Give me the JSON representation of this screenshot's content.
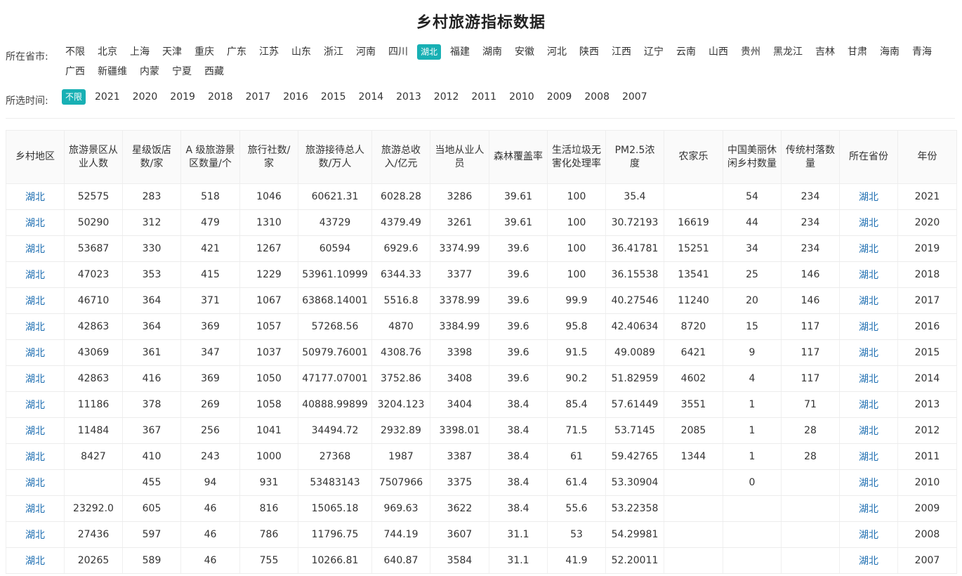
{
  "page": {
    "title": "乡村旅游指标数据"
  },
  "filters": {
    "province_label": "所在省市:",
    "provinces": [
      "不限",
      "北京",
      "上海",
      "天津",
      "重庆",
      "广东",
      "江苏",
      "山东",
      "浙江",
      "河南",
      "四川",
      "湖北",
      "福建",
      "湖南",
      "安徽",
      "河北",
      "陕西",
      "江西",
      "辽宁",
      "云南",
      "山西",
      "贵州",
      "黑龙江",
      "吉林",
      "甘肃",
      "海南",
      "青海",
      "广西",
      "新疆维",
      "内蒙",
      "宁夏",
      "西藏"
    ],
    "province_selected": "湖北",
    "time_label": "所选时间:",
    "years": [
      "不限",
      "2021",
      "2020",
      "2019",
      "2018",
      "2017",
      "2016",
      "2015",
      "2014",
      "2013",
      "2012",
      "2011",
      "2010",
      "2009",
      "2008",
      "2007"
    ],
    "year_selected": "不限"
  },
  "table": {
    "headers": [
      "乡村地区",
      "旅游景区从业人数",
      "星级饭店数/家",
      "A 级旅游景区数量/个",
      "旅行社数/家",
      "旅游接待总人数/万人",
      "旅游总收入/亿元",
      "当地从业人员",
      "森林覆盖率",
      "生活垃圾无害化处理率",
      "PM2.5浓度",
      "农家乐",
      "中国美丽休闲乡村数量",
      "传统村落数量",
      "所在省份",
      "年份"
    ],
    "link_columns": [
      0,
      14
    ],
    "rows": [
      [
        "湖北",
        "52575",
        "283",
        "518",
        "1046",
        "60621.31",
        "6028.28",
        "3286",
        "39.61",
        "100",
        "35.4",
        "",
        "54",
        "234",
        "湖北",
        "2021"
      ],
      [
        "湖北",
        "50290",
        "312",
        "479",
        "1310",
        "43729",
        "4379.49",
        "3261",
        "39.61",
        "100",
        "30.72193",
        "16619",
        "44",
        "234",
        "湖北",
        "2020"
      ],
      [
        "湖北",
        "53687",
        "330",
        "421",
        "1267",
        "60594",
        "6929.6",
        "3374.99",
        "39.6",
        "100",
        "36.41781",
        "15251",
        "34",
        "234",
        "湖北",
        "2019"
      ],
      [
        "湖北",
        "47023",
        "353",
        "415",
        "1229",
        "53961.10999",
        "6344.33",
        "3377",
        "39.6",
        "100",
        "36.15538",
        "13541",
        "25",
        "146",
        "湖北",
        "2018"
      ],
      [
        "湖北",
        "46710",
        "364",
        "371",
        "1067",
        "63868.14001",
        "5516.8",
        "3378.99",
        "39.6",
        "99.9",
        "40.27546",
        "11240",
        "20",
        "146",
        "湖北",
        "2017"
      ],
      [
        "湖北",
        "42863",
        "364",
        "369",
        "1057",
        "57268.56",
        "4870",
        "3384.99",
        "39.6",
        "95.8",
        "42.40634",
        "8720",
        "15",
        "117",
        "湖北",
        "2016"
      ],
      [
        "湖北",
        "43069",
        "361",
        "347",
        "1037",
        "50979.76001",
        "4308.76",
        "3398",
        "39.6",
        "91.5",
        "49.0089",
        "6421",
        "9",
        "117",
        "湖北",
        "2015"
      ],
      [
        "湖北",
        "42863",
        "416",
        "369",
        "1050",
        "47177.07001",
        "3752.86",
        "3408",
        "39.6",
        "90.2",
        "51.82959",
        "4602",
        "4",
        "117",
        "湖北",
        "2014"
      ],
      [
        "湖北",
        "11186",
        "378",
        "269",
        "1058",
        "40888.99899",
        "3204.123",
        "3404",
        "38.4",
        "85.4",
        "57.61449",
        "3551",
        "1",
        "71",
        "湖北",
        "2013"
      ],
      [
        "湖北",
        "11484",
        "367",
        "256",
        "1041",
        "34494.72",
        "2932.89",
        "3398.01",
        "38.4",
        "71.5",
        "53.7145",
        "2085",
        "1",
        "28",
        "湖北",
        "2012"
      ],
      [
        "湖北",
        "8427",
        "410",
        "243",
        "1000",
        "27368",
        "1987",
        "3387",
        "38.4",
        "61",
        "59.42765",
        "1344",
        "1",
        "28",
        "湖北",
        "2011"
      ],
      [
        "湖北",
        "",
        "455",
        "94",
        "931",
        "53483143",
        "7507966",
        "3375",
        "38.4",
        "61.4",
        "53.30904",
        "",
        "0",
        "",
        "湖北",
        "2010"
      ],
      [
        "湖北",
        "23292.0",
        "605",
        "46",
        "816",
        "15065.18",
        "969.63",
        "3622",
        "38.4",
        "55.6",
        "53.22358",
        "",
        "",
        "",
        "湖北",
        "2009"
      ],
      [
        "湖北",
        "27436",
        "597",
        "46",
        "786",
        "11796.75",
        "744.19",
        "3607",
        "31.1",
        "53",
        "54.29981",
        "",
        "",
        "",
        "湖北",
        "2008"
      ],
      [
        "湖北",
        "20265",
        "589",
        "46",
        "755",
        "10266.81",
        "640.87",
        "3584",
        "31.1",
        "41.9",
        "52.20011",
        "",
        "",
        "",
        "湖北",
        "2007"
      ]
    ]
  },
  "colors": {
    "accent": "#18b0b4",
    "link": "#1f6fb2"
  }
}
